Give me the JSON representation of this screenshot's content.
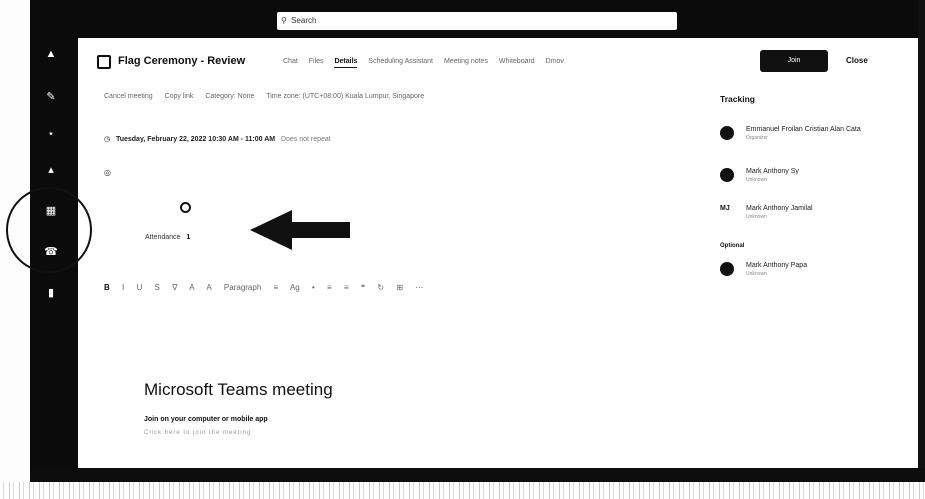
{
  "search": {
    "placeholder": "Search"
  },
  "meeting": {
    "title": "Flag Ceremony - Review",
    "tabs": [
      "Chat",
      "Files",
      "Details",
      "Scheduling Assistant",
      "Meeting notes",
      "Whiteboard",
      "Dmov"
    ],
    "active_tab": "Details",
    "join_label": "Join",
    "close_label": "Close"
  },
  "actions": [
    "Cancel meeting",
    "Copy link",
    "Category: None",
    "Time zone: (UTC+08:00) Kuala Lumpur, Singapore"
  ],
  "dateline": {
    "date": "Tuesday, February 22, 2022 10:30 AM - 11:00 AM",
    "repeat": "Does not repeat"
  },
  "attendance": {
    "label": "Attendance",
    "value": "1"
  },
  "toolbar": [
    "B",
    "I",
    "U",
    "S",
    "∇",
    "A",
    "A",
    "Paragraph",
    "≡",
    "Ag",
    "•",
    "≡",
    "≡",
    "❝",
    "↻",
    "⊞",
    "⋯"
  ],
  "body": {
    "teams_title": "Microsoft Teams meeting",
    "join_line": "Join on your computer or mobile app",
    "join_sub": "Click here to join the meeting"
  },
  "tracking": {
    "heading": "Tracking",
    "optional_label": "Optional",
    "people": [
      {
        "name": "Emmanuel Froilan Cristian Alan Cata",
        "role": "Organizer",
        "avatar": "photo"
      },
      {
        "name": "Mark Anthony Sy",
        "role": "Unknown",
        "avatar": "photo"
      },
      {
        "name": "Mark Anthony Jamilal",
        "role": "Unknown",
        "avatar": "MJ"
      },
      {
        "name": "Mark Anthony Papa",
        "role": "Unknown",
        "avatar": "photo"
      }
    ]
  }
}
